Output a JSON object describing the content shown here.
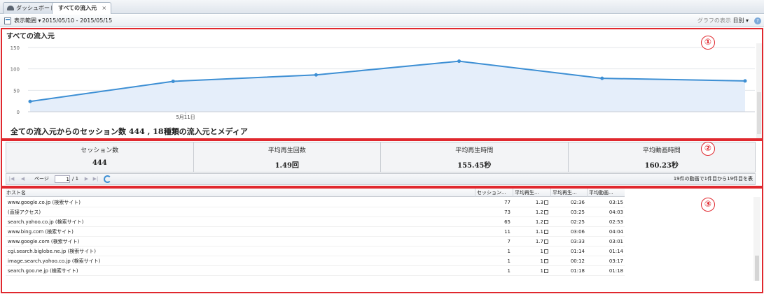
{
  "tabs": [
    {
      "label": "ダッシュボード",
      "icon": "dashboard-icon"
    },
    {
      "label": "すべての流入元",
      "close": "×"
    }
  ],
  "toolbar": {
    "range_label": "表示範囲 ▾",
    "date_range": "2015/05/10 - 2015/05/15",
    "graph_label": "グラフの表示",
    "graph_value": "日別 ▾",
    "help": "?"
  },
  "markers": [
    "①",
    "②",
    "③"
  ],
  "chart": {
    "title": "すべての流入元",
    "summary": "全ての流入元からのセッション数 444 , 18種類の流入元とメディア"
  },
  "chart_data": {
    "type": "area",
    "y_ticks": [
      0,
      50,
      100,
      150
    ],
    "ylim": [
      0,
      150
    ],
    "x_tick_label": "5月11日",
    "values": [
      24,
      71,
      86,
      118,
      78,
      72
    ],
    "grid": true,
    "accent": "#3d8fd4",
    "fill": "#e5eefa"
  },
  "stats": [
    {
      "label": "セッション数",
      "value": "444"
    },
    {
      "label": "平均再生回数",
      "value": "1.49回"
    },
    {
      "label": "平均再生時間",
      "value": "155.45秒"
    },
    {
      "label": "平均動画時間",
      "value": "160.23秒"
    }
  ],
  "pager": {
    "page_label": "ページ",
    "page_value": "1",
    "page_total": "/ 1",
    "info": "19件の動画で1件目から19件目を表"
  },
  "table": {
    "columns": [
      "ホスト名",
      "セッション...",
      "平均再生...",
      "平均再生...",
      "平均動画..."
    ],
    "rows": [
      {
        "host": "www.google.co.jp (検索サイト)",
        "sessions": "77",
        "avg_plays": "1.3",
        "avg_play_time": "02:36",
        "avg_video_time": "03:15"
      },
      {
        "host": "(直接アクセス)",
        "sessions": "73",
        "avg_plays": "1.2",
        "avg_play_time": "03:25",
        "avg_video_time": "04:03"
      },
      {
        "host": "search.yahoo.co.jp (検索サイト)",
        "sessions": "65",
        "avg_plays": "1.2",
        "avg_play_time": "02:25",
        "avg_video_time": "02:53"
      },
      {
        "host": "www.bing.com (検索サイト)",
        "sessions": "11",
        "avg_plays": "1.1",
        "avg_play_time": "03:06",
        "avg_video_time": "04:04"
      },
      {
        "host": "www.google.com (検索サイト)",
        "sessions": "7",
        "avg_plays": "1.7",
        "avg_play_time": "03:33",
        "avg_video_time": "03:01"
      },
      {
        "host": "cgi.search.biglobe.ne.jp (検索サイト)",
        "sessions": "1",
        "avg_plays": "1",
        "avg_play_time": "01:14",
        "avg_video_time": "01:14"
      },
      {
        "host": "image.search.yahoo.co.jp (検索サイト)",
        "sessions": "1",
        "avg_plays": "1",
        "avg_play_time": "00:12",
        "avg_video_time": "03:17"
      },
      {
        "host": "search.goo.ne.jp (検索サイト)",
        "sessions": "1",
        "avg_plays": "1",
        "avg_play_time": "01:18",
        "avg_video_time": "01:18"
      }
    ]
  }
}
